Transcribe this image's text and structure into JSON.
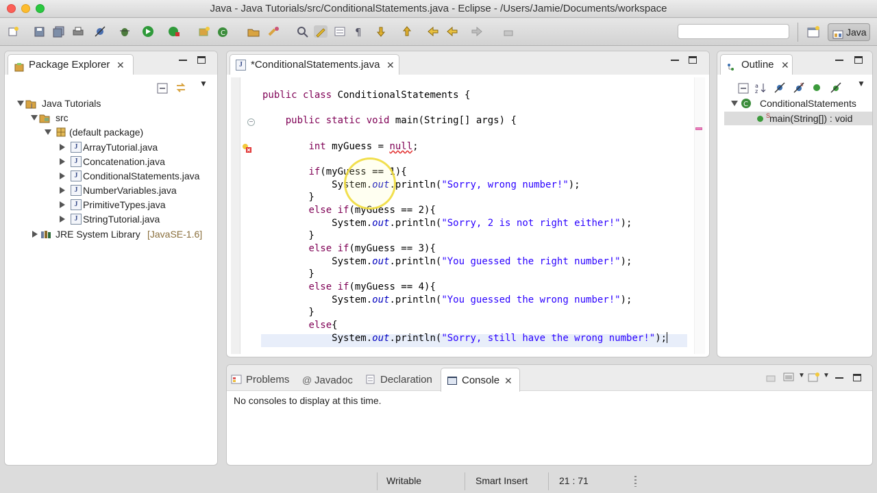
{
  "window": {
    "title": "Java - Java Tutorials/src/ConditionalStatements.java - Eclipse - /Users/Jamie/Documents/workspace"
  },
  "toolbar": {
    "quick_access_placeholder": "",
    "perspective_label": "Java"
  },
  "package_explorer": {
    "title": "Package Explorer",
    "tree": {
      "project": "Java Tutorials",
      "src": "src",
      "package": "(default package)",
      "files": [
        "ArrayTutorial.java",
        "Concatenation.java",
        "ConditionalStatements.java",
        "NumberVariables.java",
        "PrimitiveTypes.java",
        "StringTutorial.java"
      ],
      "library": "JRE System Library",
      "library_tag": "[JavaSE-1.6]"
    }
  },
  "editor": {
    "tab_label": "*ConditionalStatements.java",
    "lines": [
      {
        "parts": [
          {
            "t": "public class ",
            "c": "kw"
          },
          {
            "t": "ConditionalStatements {",
            "c": ""
          }
        ]
      },
      {
        "parts": [
          {
            "t": "    ",
            "c": ""
          },
          {
            "t": "public static void ",
            "c": "kw"
          },
          {
            "t": "main(String[] args) {",
            "c": ""
          }
        ]
      },
      {
        "parts": [
          {
            "t": "        ",
            "c": ""
          },
          {
            "t": "int ",
            "c": "kw"
          },
          {
            "t": "myGuess = ",
            "c": ""
          },
          {
            "t": "null",
            "c": "kw err-ul"
          },
          {
            "t": ";",
            "c": ""
          }
        ]
      },
      {
        "parts": [
          {
            "t": "        ",
            "c": ""
          },
          {
            "t": "if",
            "c": "kw"
          },
          {
            "t": "(myGuess == 1){",
            "c": ""
          }
        ]
      },
      {
        "parts": [
          {
            "t": "            System.",
            "c": ""
          },
          {
            "t": "out",
            "c": "fld"
          },
          {
            "t": ".println(",
            "c": ""
          },
          {
            "t": "\"Sorry, wrong number!\"",
            "c": "str"
          },
          {
            "t": ");",
            "c": ""
          }
        ]
      },
      {
        "parts": [
          {
            "t": "        }",
            "c": ""
          }
        ]
      },
      {
        "parts": [
          {
            "t": "        ",
            "c": ""
          },
          {
            "t": "else if",
            "c": "kw"
          },
          {
            "t": "(myGuess == 2){",
            "c": ""
          }
        ]
      },
      {
        "parts": [
          {
            "t": "            System.",
            "c": ""
          },
          {
            "t": "out",
            "c": "fld"
          },
          {
            "t": ".println(",
            "c": ""
          },
          {
            "t": "\"Sorry, 2 is not right either!\"",
            "c": "str"
          },
          {
            "t": ");",
            "c": ""
          }
        ]
      },
      {
        "parts": [
          {
            "t": "        }",
            "c": ""
          }
        ]
      },
      {
        "parts": [
          {
            "t": "        ",
            "c": ""
          },
          {
            "t": "else if",
            "c": "kw"
          },
          {
            "t": "(myGuess == 3){",
            "c": ""
          }
        ]
      },
      {
        "parts": [
          {
            "t": "            System.",
            "c": ""
          },
          {
            "t": "out",
            "c": "fld"
          },
          {
            "t": ".println(",
            "c": ""
          },
          {
            "t": "\"You guessed the right number!\"",
            "c": "str"
          },
          {
            "t": ");",
            "c": ""
          }
        ]
      },
      {
        "parts": [
          {
            "t": "        }",
            "c": ""
          }
        ]
      },
      {
        "parts": [
          {
            "t": "        ",
            "c": ""
          },
          {
            "t": "else if",
            "c": "kw"
          },
          {
            "t": "(myGuess == 4){",
            "c": ""
          }
        ]
      },
      {
        "parts": [
          {
            "t": "            System.",
            "c": ""
          },
          {
            "t": "out",
            "c": "fld"
          },
          {
            "t": ".println(",
            "c": ""
          },
          {
            "t": "\"You guessed the wrong number!\"",
            "c": "str"
          },
          {
            "t": ");",
            "c": ""
          }
        ]
      },
      {
        "parts": [
          {
            "t": "        }",
            "c": ""
          }
        ]
      },
      {
        "parts": [
          {
            "t": "        ",
            "c": ""
          },
          {
            "t": "else",
            "c": "kw"
          },
          {
            "t": "{",
            "c": ""
          }
        ]
      },
      {
        "parts": [
          {
            "t": "            System.",
            "c": ""
          },
          {
            "t": "out",
            "c": "fld"
          },
          {
            "t": ".println(",
            "c": ""
          },
          {
            "t": "\"Sorry, still have the wrong number!\"",
            "c": "str"
          },
          {
            "t": ");",
            "c": ""
          }
        ]
      }
    ]
  },
  "outline": {
    "title": "Outline",
    "class_name": "ConditionalStatements",
    "method": "main(String[]) : void"
  },
  "bottom_panel": {
    "tabs": [
      "Problems",
      "Javadoc",
      "Declaration",
      "Console"
    ],
    "active_tab": "Console",
    "message": "No consoles to display at this time."
  },
  "status": {
    "writable": "Writable",
    "insert_mode": "Smart Insert",
    "position": "21 : 71"
  },
  "colors": {
    "keyword": "#7f0055",
    "string": "#2a00ff",
    "field": "#0000c0",
    "current_line": "#e8eefa"
  }
}
